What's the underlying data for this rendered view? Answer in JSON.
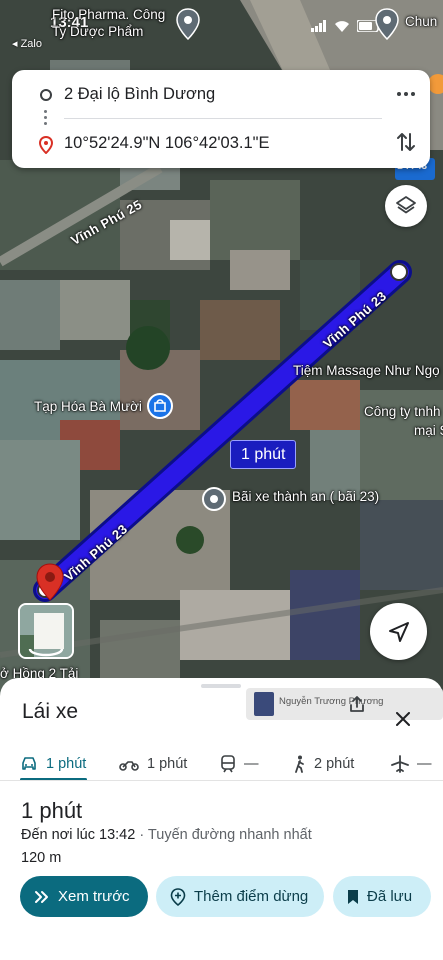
{
  "status_bar": {
    "time": "13:41",
    "back_app": "◂ Zalo"
  },
  "map_labels": {
    "top_left_poi": "Fito Pharma. Công\nTy Dược Phẩm",
    "top_right_poi": "Chun",
    "road_vinh_phu_25": "Vĩnh Phú 25",
    "road_vinh_phu_23_upper": "Vĩnh Phú 23",
    "road_vinh_phu_23_lower": "Vĩnh Phú 23",
    "poi_massage": "Tiệm Massage Như Ngọ",
    "poi_company": "Công ty tnhh",
    "poi_company_2": "mại S",
    "poi_grocery": "Tạp Hóa Bà Mười",
    "poi_parking": "Bãi xe thành an ( bãi 23)",
    "poi_bottom_left": "ở Hồng 2 Tải",
    "route_sign": "ĐT743"
  },
  "route_card": {
    "origin": "2 Đại lộ Bình Dương",
    "destination": "10°52'24.9\"N 106°42'03.1\"E"
  },
  "route_duration_chip": "1 phút",
  "sheet": {
    "title": "Lái xe",
    "shared_user": "Nguyễn Trương Phương",
    "tabs": [
      {
        "label": "1 phút",
        "icon": "car-icon",
        "active": true
      },
      {
        "label": "1 phút",
        "icon": "motorbike-icon",
        "active": false
      },
      {
        "label": "—",
        "icon": "transit-icon",
        "active": false
      },
      {
        "label": "2 phút",
        "icon": "walk-icon",
        "active": false
      },
      {
        "label": "—",
        "icon": "plane-icon",
        "active": false
      }
    ],
    "duration": "1 phút",
    "arrival_prefix": "Đến nơi lúc 13:42",
    "arrival_suffix": " · Tuyến đường nhanh nhất",
    "distance": "120 m",
    "buttons": {
      "preview": "Xem trước",
      "add_stop": "Thêm điểm dừng",
      "saved": "Đã lưu"
    }
  },
  "colors": {
    "route_blue": "#2a18e6",
    "primary_teal": "#0b6b7f",
    "secondary_chip": "#cdeef7",
    "pin_red": "#d93025"
  }
}
